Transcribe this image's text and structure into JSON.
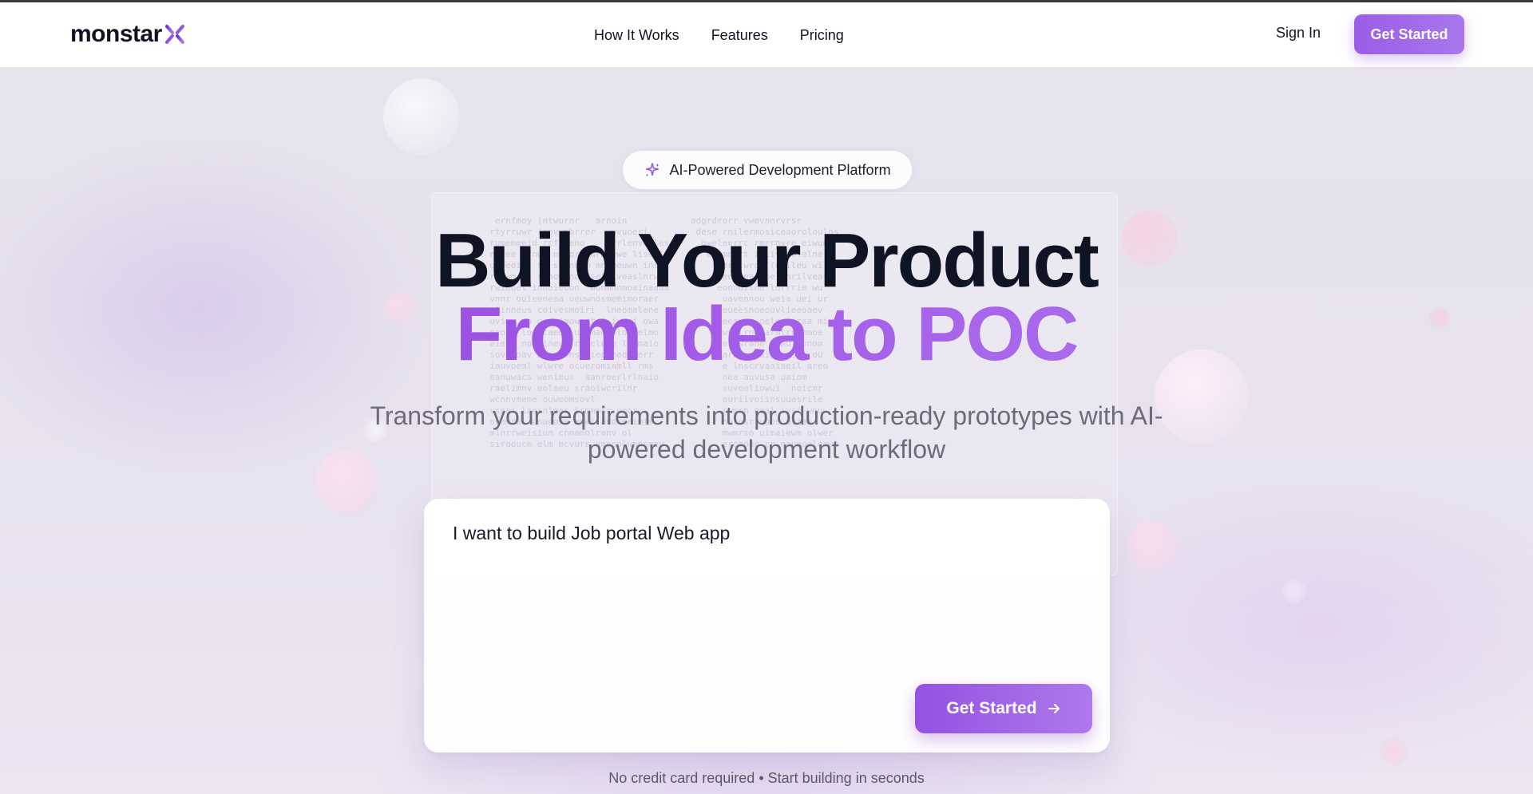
{
  "brand": {
    "name": "monstar",
    "accent": "#9b5de5",
    "logo_mark_icon": "x-mark-icon"
  },
  "nav": {
    "items": [
      {
        "label": "How It Works"
      },
      {
        "label": "Features"
      },
      {
        "label": "Pricing"
      }
    ],
    "sign_in_label": "Sign In",
    "cta_label": "Get Started"
  },
  "hero": {
    "badge": {
      "icon": "sparkle-icon",
      "label": "AI-Powered Development Platform"
    },
    "headline_line1": "Build Your Product",
    "headline_line2": "From Idea to POC",
    "subtitle": "Transform your requirements into production-ready prototypes with AI-powered development workflow",
    "prompt": {
      "value": "I want to build Job portal Web app",
      "cta_label": "Get Started",
      "cta_icon": "arrow-right-icon"
    },
    "footnote": "No credit card required • Start building in seconds"
  }
}
